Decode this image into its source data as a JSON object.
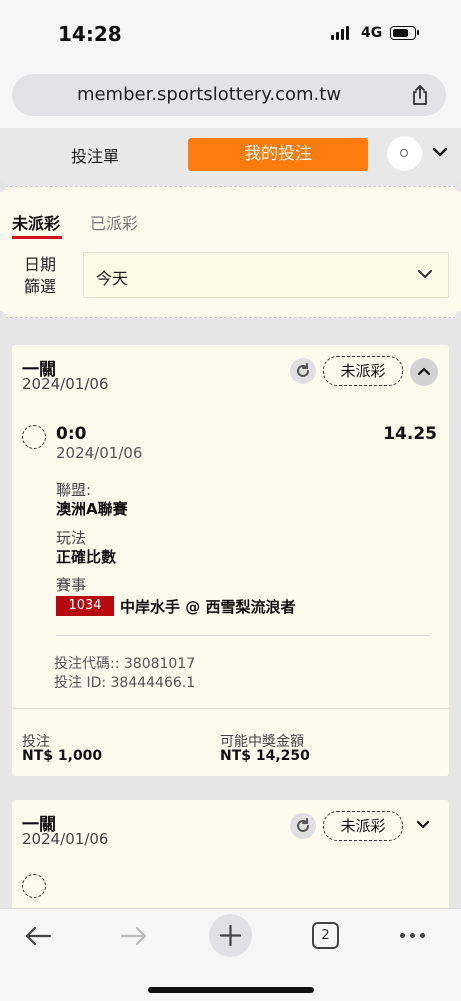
{
  "status_bar": {
    "time": "14:28",
    "network": "4G"
  },
  "browser": {
    "url": "member.sportslottery.com.tw",
    "tab_count": "2"
  },
  "top_nav": {
    "betslip_label": "投注單",
    "mybets_label": "我的投注",
    "accent_color": "#ff7b0d"
  },
  "filters": {
    "tab_open": "未派彩",
    "tab_settled": "已派彩",
    "date_label": "日期篩選",
    "date_value": "今天"
  },
  "bets": [
    {
      "type": "一關",
      "date": "2024/01/06",
      "status": "未派彩",
      "selection": "0:0",
      "odds": "14.25",
      "selection_date": "2024/01/06",
      "league_label": "聯盟:",
      "league": "澳洲A聯賽",
      "market_label": "玩法",
      "market": "正確比數",
      "event_label": "賽事",
      "event_code": "1034",
      "event_name": "中岸水手 @ 西雪梨流浪者",
      "bet_code": "投注代碼:: 38081017",
      "bet_id": "投注 ID: 38444466.1",
      "stake_label": "投注",
      "stake": "NT$ 1,000",
      "payout_label": "可能中獎金額",
      "payout": "NT$ 14,250"
    },
    {
      "type": "一關",
      "date": "2024/01/06",
      "status": "未派彩"
    }
  ],
  "icons": [
    "share-icon",
    "gear-icon",
    "chevron-down-icon",
    "refresh-icon",
    "chevron-up-icon",
    "back-arrow-icon",
    "forward-arrow-icon",
    "plus-icon",
    "tabs-icon",
    "more-icon"
  ]
}
